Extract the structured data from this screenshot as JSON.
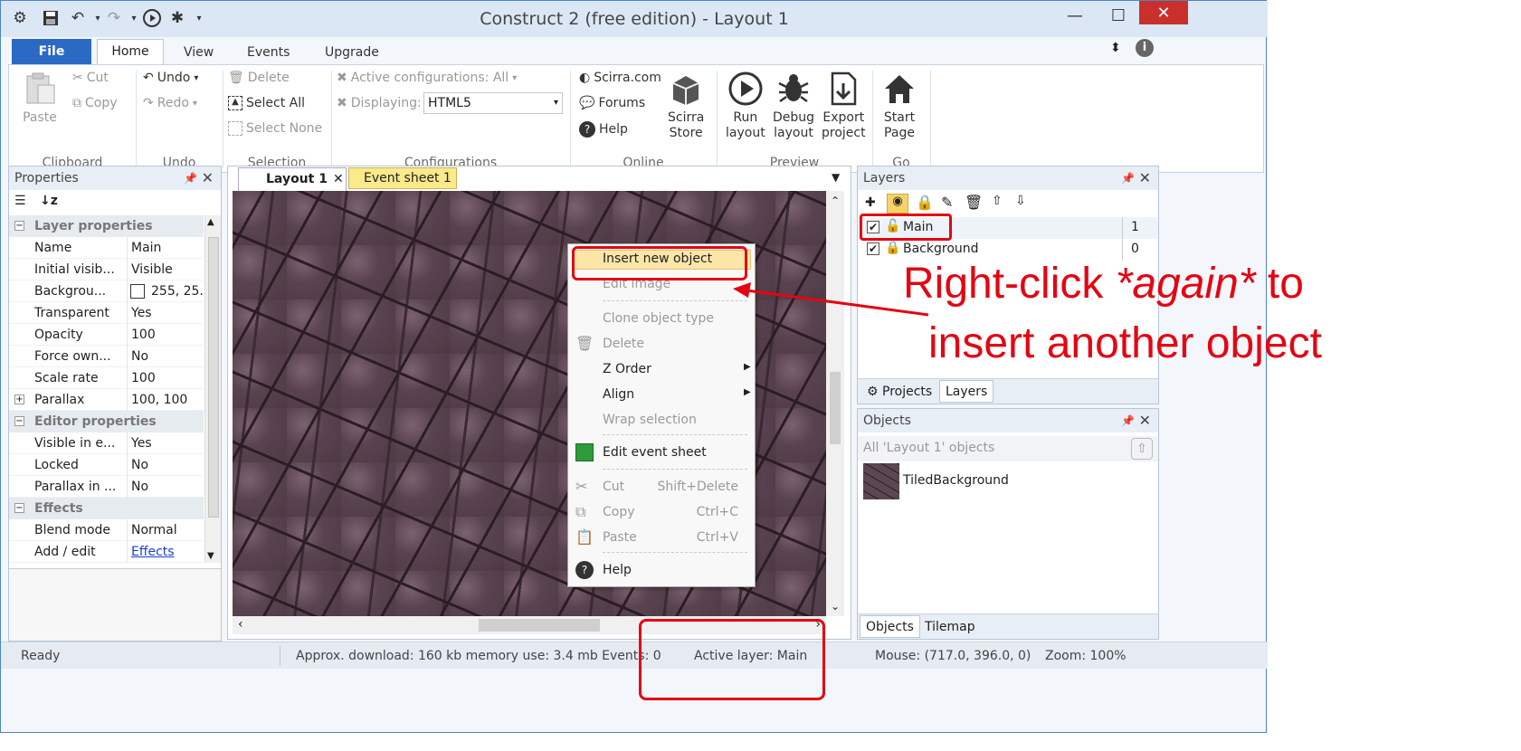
{
  "window": {
    "title": "Construct 2  (free edition) - Layout 1"
  },
  "ribbon_tabs": {
    "file": "File",
    "home": "Home",
    "view": "View",
    "events": "Events",
    "upgrade": "Upgrade"
  },
  "clipboard": {
    "paste": "Paste",
    "cut": "Cut",
    "copy": "Copy",
    "label": "Clipboard"
  },
  "undo": {
    "undo": "Undo",
    "redo": "Redo",
    "label": "Undo"
  },
  "selection": {
    "delete": "Delete",
    "select_all": "Select All",
    "select_none": "Select None",
    "label": "Selection"
  },
  "configurations": {
    "active": "Active configurations: All",
    "displaying": "Displaying:",
    "displaying_value": "HTML5",
    "label": "Configurations"
  },
  "online": {
    "scirra": "Scirra.com",
    "forums": "Forums",
    "help": "Help",
    "store": "Scirra\nStore",
    "store_l1": "Scirra",
    "store_l2": "Store",
    "label": "Online"
  },
  "preview": {
    "run_l1": "Run",
    "run_l2": "layout",
    "debug_l1": "Debug",
    "debug_l2": "layout",
    "export_l1": "Export",
    "export_l2": "project",
    "label": "Preview"
  },
  "go": {
    "start_l1": "Start",
    "start_l2": "Page",
    "label": "Go"
  },
  "properties": {
    "title": "Properties",
    "cat_layer": "Layer properties",
    "rows1": [
      {
        "k": "Name",
        "v": "Main"
      },
      {
        "k": "Initial visib...",
        "v": "Visible"
      },
      {
        "k": "Backgrou...",
        "v": "255, 25..."
      },
      {
        "k": "Transparent",
        "v": "Yes"
      },
      {
        "k": "Opacity",
        "v": "100"
      },
      {
        "k": "Force own...",
        "v": "No"
      },
      {
        "k": "Scale rate",
        "v": "100"
      },
      {
        "k": "Parallax",
        "v": "100, 100"
      }
    ],
    "cat_editor": "Editor properties",
    "rows2": [
      {
        "k": "Visible in e...",
        "v": "Yes"
      },
      {
        "k": "Locked",
        "v": "No"
      },
      {
        "k": "Parallax in ...",
        "v": "No"
      }
    ],
    "cat_effects": "Effects",
    "rows3": [
      {
        "k": "Blend mode",
        "v": "Normal"
      },
      {
        "k": "Add / edit",
        "v": "Effects"
      }
    ]
  },
  "doc_tabs": {
    "layout": "Layout 1",
    "events": "Event sheet 1"
  },
  "context_menu": {
    "insert": "Insert new object",
    "edit_image": "Edit image",
    "clone": "Clone object type",
    "delete": "Delete",
    "zorder": "Z Order",
    "align": "Align",
    "wrap": "Wrap selection",
    "edit_events": "Edit event sheet",
    "cut": "Cut",
    "cut_sc": "Shift+Delete",
    "copy": "Copy",
    "copy_sc": "Ctrl+C",
    "paste": "Paste",
    "paste_sc": "Ctrl+V",
    "help": "Help"
  },
  "layers": {
    "title": "Layers",
    "items": [
      {
        "name": "Main",
        "num": "1"
      },
      {
        "name": "Background",
        "num": "0"
      }
    ],
    "tab_projects": "Projects",
    "tab_layers": "Layers"
  },
  "objects": {
    "title": "Objects",
    "filter": "All 'Layout 1' objects",
    "items": [
      {
        "name": "TiledBackground"
      }
    ],
    "tab_objects": "Objects",
    "tab_tilemap": "Tilemap"
  },
  "status": {
    "ready": "Ready",
    "download": "Approx. download: 160 kb  memory use: 3.4 mb  Events: 0",
    "active_layer": "Active layer: Main",
    "mouse": "Mouse: (717.0, 396.0, 0)",
    "zoom": "Zoom: 100%"
  },
  "annotation": {
    "line1_pre": "Right-click ",
    "line1_em": "*again*",
    "line1_post": " to",
    "line2": "insert another object"
  },
  "colors": {
    "accent": "#2b6ac4",
    "annotation_red": "#e30613",
    "event_tab": "#fbe98a"
  }
}
